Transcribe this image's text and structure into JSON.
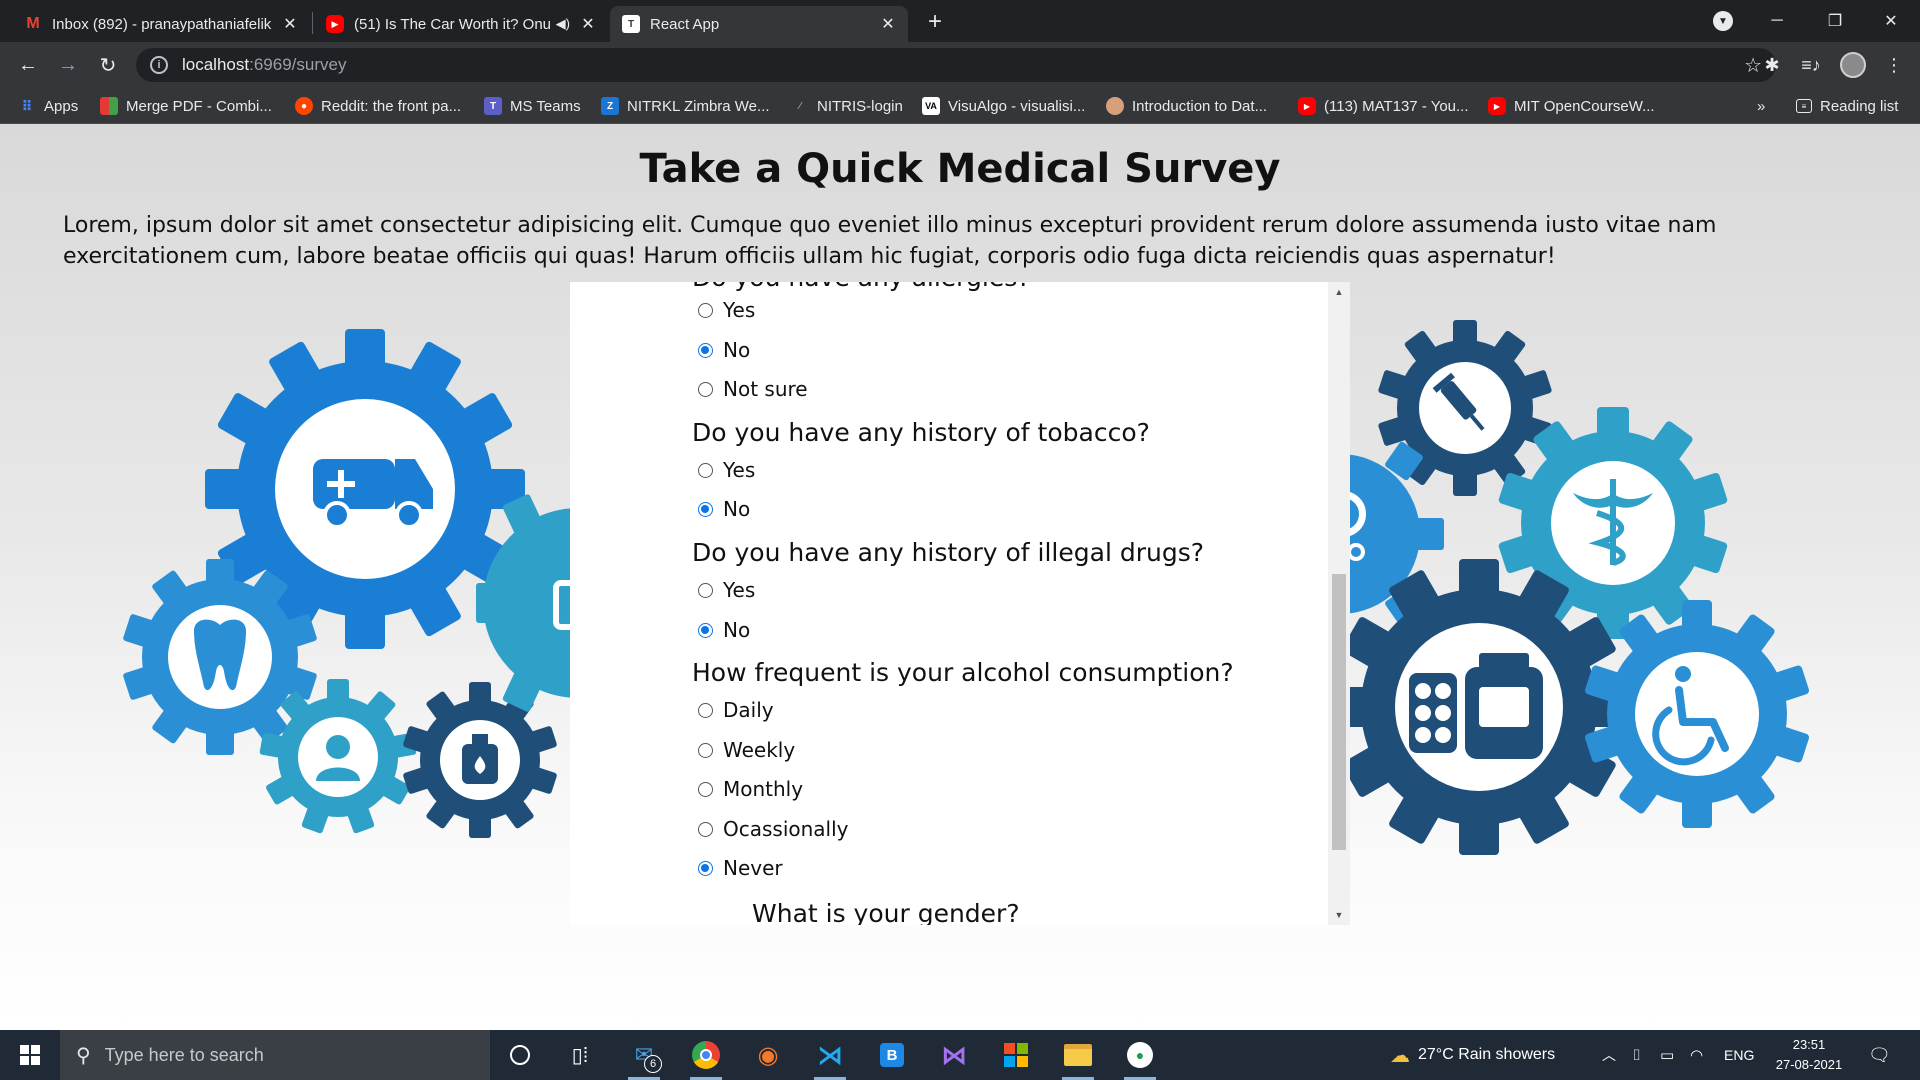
{
  "browser": {
    "tabs": [
      {
        "title": "Inbox (892) - pranaypathaniafelik",
        "icon": "gmail-icon",
        "active": false
      },
      {
        "title": "(51) Is The Car Worth it? Onu",
        "icon": "youtube-icon",
        "active": false
      },
      {
        "title": "React App",
        "icon": "react-app-icon",
        "active": true
      }
    ],
    "url_host": "localhost",
    "url_path": ":6969/survey",
    "bookmarks": [
      {
        "label": "Apps",
        "icon": "apps-grid-icon"
      },
      {
        "label": "Merge PDF - Combi...",
        "icon": "merge-pdf-icon"
      },
      {
        "label": "Reddit: the front pa...",
        "icon": "reddit-icon"
      },
      {
        "label": "MS Teams",
        "icon": "teams-icon"
      },
      {
        "label": "NITRKL Zimbra We...",
        "icon": "zimbra-icon"
      },
      {
        "label": "NITRIS-login",
        "icon": "nitris-icon"
      },
      {
        "label": "VisuAlgo - visualisi...",
        "icon": "visualgo-icon"
      },
      {
        "label": "Introduction to Dat...",
        "icon": "avatar-icon"
      },
      {
        "label": "(113) MAT137 - You...",
        "icon": "youtube-icon"
      },
      {
        "label": "MIT OpenCourseW...",
        "icon": "youtube-icon"
      }
    ],
    "bookmarks_more": "»",
    "reading_list": "Reading list"
  },
  "page": {
    "title": "Take a Quick Medical Survey",
    "intro": "Lorem, ipsum dolor sit amet consectetur adipisicing elit. Cumque quo eveniet illo minus excepturi provident rerum dolore assumenda iusto vitae nam exercitationem cum, labore beatae officiis qui quas! Harum officiis ullam hic fugiat, corporis odio fuga dicta reiciendis quas aspernatur!"
  },
  "survey": {
    "q_allergies": "Do you have any allergies?",
    "allergies_options": [
      "Yes",
      "No",
      "Not sure"
    ],
    "allergies_selected": "No",
    "q_tobacco": "Do you have any history of tobacco?",
    "tobacco_options": [
      "Yes",
      "No"
    ],
    "tobacco_selected": "No",
    "q_drugs": "Do you have any history of illegal drugs?",
    "drugs_options": [
      "Yes",
      "No"
    ],
    "drugs_selected": "No",
    "q_alcohol": "How frequent is your alcohol consumption?",
    "alcohol_options": [
      "Daily",
      "Weekly",
      "Monthly",
      "Ocassionally",
      "Never"
    ],
    "alcohol_selected": "Never",
    "q_gender": "What is your gender?"
  },
  "taskbar": {
    "search_placeholder": "Type here to search",
    "mail_badge": "6",
    "weather": "27°C  Rain showers",
    "language": "ENG",
    "time": "23:51",
    "date": "27-08-2021"
  },
  "colors": {
    "gear_blue": "#1a7fd4",
    "gear_teal": "#2fa0c8",
    "gear_navy": "#1f4e79",
    "radio_checked": "#0b74e6"
  }
}
